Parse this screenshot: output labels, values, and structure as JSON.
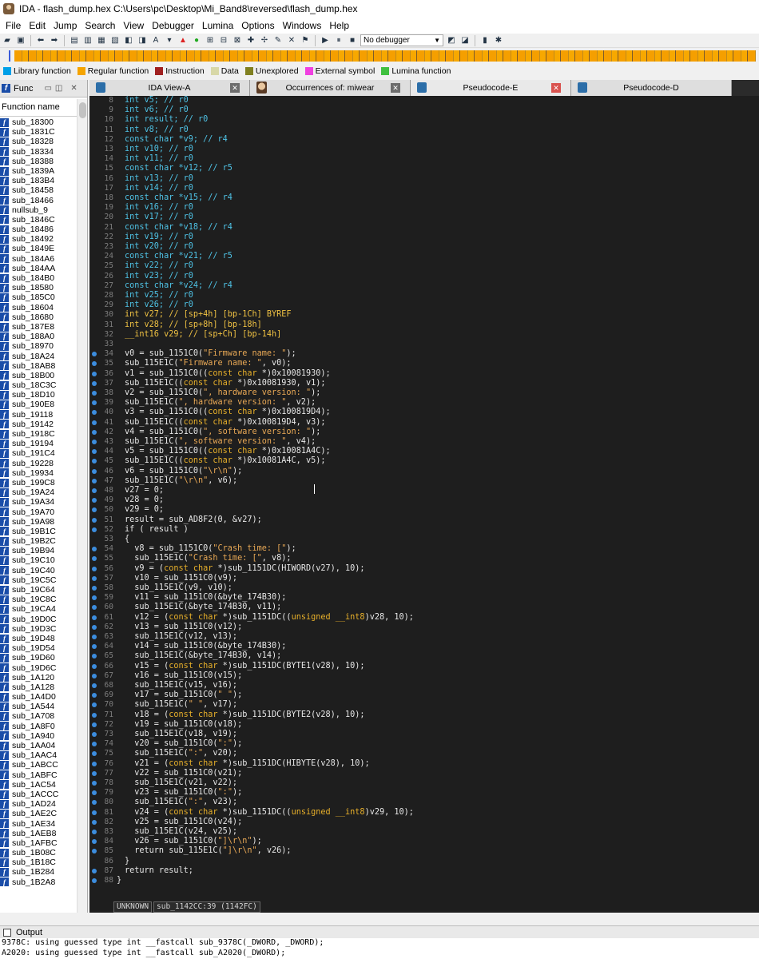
{
  "window": {
    "title": "IDA - flash_dump.hex C:\\Users\\pc\\Desktop\\Mi_Band8\\reversed\\flash_dump.hex"
  },
  "menu": [
    "File",
    "Edit",
    "Jump",
    "Search",
    "View",
    "Debugger",
    "Lumina",
    "Options",
    "Windows",
    "Help"
  ],
  "toolbar": {
    "debugger": "No debugger"
  },
  "legend": [
    {
      "label": "Library function",
      "color": "#00a0e8"
    },
    {
      "label": "Regular function",
      "color": "#f5a400"
    },
    {
      "label": "Instruction",
      "color": "#a02020"
    },
    {
      "label": "Data",
      "color": "#d8d8a8"
    },
    {
      "label": "Unexplored",
      "color": "#808020"
    },
    {
      "label": "External symbol",
      "color": "#f040e0"
    },
    {
      "label": "Lumina function",
      "color": "#40c040"
    }
  ],
  "functions_panel": {
    "tab_label": "Func",
    "column_header": "Function name",
    "items": [
      "sub_18300",
      "sub_1831C",
      "sub_18328",
      "sub_18334",
      "sub_18388",
      "sub_1839A",
      "sub_183B4",
      "sub_18458",
      "sub_18466",
      "nullsub_9",
      "sub_1846C",
      "sub_18486",
      "sub_18492",
      "sub_1849E",
      "sub_184A6",
      "sub_184AA",
      "sub_184B0",
      "sub_18580",
      "sub_185C0",
      "sub_18604",
      "sub_18680",
      "sub_187E8",
      "sub_188A0",
      "sub_18970",
      "sub_18A24",
      "sub_18AB8",
      "sub_18B00",
      "sub_18C3C",
      "sub_18D10",
      "sub_190E8",
      "sub_19118",
      "sub_19142",
      "sub_1918C",
      "sub_19194",
      "sub_191C4",
      "sub_19228",
      "sub_19934",
      "sub_199C8",
      "sub_19A24",
      "sub_19A34",
      "sub_19A70",
      "sub_19A98",
      "sub_19B1C",
      "sub_19B2C",
      "sub_19B94",
      "sub_19C10",
      "sub_19C40",
      "sub_19C5C",
      "sub_19C64",
      "sub_19C8C",
      "sub_19CA4",
      "sub_19D0C",
      "sub_19D3C",
      "sub_19D48",
      "sub_19D54",
      "sub_19D60",
      "sub_19D6C",
      "sub_1A120",
      "sub_1A128",
      "sub_1A4D0",
      "sub_1A544",
      "sub_1A708",
      "sub_1A8F0",
      "sub_1A940",
      "sub_1AA04",
      "sub_1AAC4",
      "sub_1ABCC",
      "sub_1ABFC",
      "sub_1AC54",
      "sub_1ACCC",
      "sub_1AD24",
      "sub_1AE2C",
      "sub_1AE34",
      "sub_1AEB8",
      "sub_1AFBC",
      "sub_1B08C",
      "sub_1B18C",
      "sub_1B284",
      "sub_1B2A8"
    ]
  },
  "tabs": [
    {
      "label": "IDA View-A",
      "active": false
    },
    {
      "label": "Occurrences of: miwear",
      "active": false
    },
    {
      "label": "Pseudocode-E",
      "active": true
    },
    {
      "label": "Pseudocode-D",
      "active": false
    }
  ],
  "code": [
    {
      "n": "8",
      "t": "int v5; // r0",
      "k": "decl"
    },
    {
      "n": "9",
      "t": "int v6; // r0",
      "k": "decl"
    },
    {
      "n": "10",
      "t": "int result; // r0",
      "k": "decl"
    },
    {
      "n": "11",
      "t": "int v8; // r0",
      "k": "decl"
    },
    {
      "n": "12",
      "t": "const char *v9; // r4",
      "k": "decl"
    },
    {
      "n": "13",
      "t": "int v10; // r0",
      "k": "decl"
    },
    {
      "n": "14",
      "t": "int v11; // r0",
      "k": "decl"
    },
    {
      "n": "15",
      "t": "const char *v12; // r5",
      "k": "decl"
    },
    {
      "n": "16",
      "t": "int v13; // r0",
      "k": "decl"
    },
    {
      "n": "17",
      "t": "int v14; // r0",
      "k": "decl"
    },
    {
      "n": "18",
      "t": "const char *v15; // r4",
      "k": "decl"
    },
    {
      "n": "19",
      "t": "int v16; // r0",
      "k": "decl"
    },
    {
      "n": "20",
      "t": "int v17; // r0",
      "k": "decl"
    },
    {
      "n": "21",
      "t": "const char *v18; // r4",
      "k": "decl"
    },
    {
      "n": "22",
      "t": "int v19; // r0",
      "k": "decl"
    },
    {
      "n": "23",
      "t": "int v20; // r0",
      "k": "decl"
    },
    {
      "n": "24",
      "t": "const char *v21; // r5",
      "k": "decl"
    },
    {
      "n": "25",
      "t": "int v22; // r0",
      "k": "decl"
    },
    {
      "n": "26",
      "t": "int v23; // r0",
      "k": "decl"
    },
    {
      "n": "27",
      "t": "const char *v24; // r4",
      "k": "decl"
    },
    {
      "n": "28",
      "t": "int v25; // r0",
      "k": "decl"
    },
    {
      "n": "29",
      "t": "int v26; // r0",
      "k": "decl"
    },
    {
      "n": "30",
      "t": "int v27; // [sp+4h] [bp-1Ch] BYREF",
      "k": "decl2"
    },
    {
      "n": "31",
      "t": "int v28; // [sp+8h] [bp-18h]",
      "k": "decl2"
    },
    {
      "n": "32",
      "t": "__int16 v29; // [sp+Ch] [bp-14h]",
      "k": "decl2"
    },
    {
      "n": "33",
      "t": "",
      "k": ""
    },
    {
      "n": "34",
      "t": "v0 = sub_1151C0(\"Firmware name: \");",
      "k": "dot"
    },
    {
      "n": "35",
      "t": "sub_115E1C(\"Firmware name: \", v0);",
      "k": "dot"
    },
    {
      "n": "36",
      "t": "v1 = sub_1151C0((const char *)0x10081930);",
      "k": "dot"
    },
    {
      "n": "37",
      "t": "sub_115E1C((const char *)0x10081930, v1);",
      "k": "dot"
    },
    {
      "n": "38",
      "t": "v2 = sub_1151C0(\", hardware version: \");",
      "k": "dot"
    },
    {
      "n": "39",
      "t": "sub_115E1C(\", hardware version: \", v2);",
      "k": "dot"
    },
    {
      "n": "40",
      "t": "v3 = sub_1151C0((const char *)0x100819D4);",
      "k": "dot"
    },
    {
      "n": "41",
      "t": "sub_115E1C((const char *)0x100819D4, v3);",
      "k": "dot"
    },
    {
      "n": "42",
      "t": "v4 = sub_1151C0(\", software version: \");",
      "k": "dot"
    },
    {
      "n": "43",
      "t": "sub_115E1C(\", software version: \", v4);",
      "k": "dot"
    },
    {
      "n": "44",
      "t": "v5 = sub_1151C0((const char *)0x10081A4C);",
      "k": "dot"
    },
    {
      "n": "45",
      "t": "sub_115E1C((const char *)0x10081A4C, v5);",
      "k": "dot"
    },
    {
      "n": "46",
      "t": "v6 = sub_1151C0(\"\\r\\n\");",
      "k": "dot"
    },
    {
      "n": "47",
      "t": "sub_115E1C(\"\\r\\n\", v6);",
      "k": "dot"
    },
    {
      "n": "48",
      "t": "v27 = 0;",
      "k": "dot"
    },
    {
      "n": "49",
      "t": "v28 = 0;",
      "k": "dot"
    },
    {
      "n": "50",
      "t": "v29 = 0;",
      "k": "dot"
    },
    {
      "n": "51",
      "t": "result = sub_AD8F2(0, &v27);",
      "k": "dot"
    },
    {
      "n": "52",
      "t": "if ( result )",
      "k": "dot"
    },
    {
      "n": "53",
      "t": "{",
      "k": ""
    },
    {
      "n": "54",
      "t": "  v8 = sub_1151C0(\"Crash time: [\");",
      "k": "dot"
    },
    {
      "n": "55",
      "t": "  sub_115E1C(\"Crash time: [\", v8);",
      "k": "dot"
    },
    {
      "n": "56",
      "t": "  v9 = (const char *)sub_1151DC(HIWORD(v27), 10);",
      "k": "dot"
    },
    {
      "n": "57",
      "t": "  v10 = sub_1151C0(v9);",
      "k": "dot"
    },
    {
      "n": "58",
      "t": "  sub_115E1C(v9, v10);",
      "k": "dot"
    },
    {
      "n": "59",
      "t": "  v11 = sub_1151C0(&byte_174B30);",
      "k": "dot"
    },
    {
      "n": "60",
      "t": "  sub_115E1C(&byte_174B30, v11);",
      "k": "dot"
    },
    {
      "n": "61",
      "t": "  v12 = (const char *)sub_1151DC((unsigned __int8)v28, 10);",
      "k": "dot"
    },
    {
      "n": "62",
      "t": "  v13 = sub_1151C0(v12);",
      "k": "dot"
    },
    {
      "n": "63",
      "t": "  sub_115E1C(v12, v13);",
      "k": "dot"
    },
    {
      "n": "64",
      "t": "  v14 = sub_1151C0(&byte_174B30);",
      "k": "dot"
    },
    {
      "n": "65",
      "t": "  sub_115E1C(&byte_174B30, v14);",
      "k": "dot"
    },
    {
      "n": "66",
      "t": "  v15 = (const char *)sub_1151DC(BYTE1(v28), 10);",
      "k": "dot"
    },
    {
      "n": "67",
      "t": "  v16 = sub_1151C0(v15);",
      "k": "dot"
    },
    {
      "n": "68",
      "t": "  sub_115E1C(v15, v16);",
      "k": "dot"
    },
    {
      "n": "69",
      "t": "  v17 = sub_1151C0(\" \");",
      "k": "dot"
    },
    {
      "n": "70",
      "t": "  sub_115E1C(\" \", v17);",
      "k": "dot"
    },
    {
      "n": "71",
      "t": "  v18 = (const char *)sub_1151DC(BYTE2(v28), 10);",
      "k": "dot"
    },
    {
      "n": "72",
      "t": "  v19 = sub_1151C0(v18);",
      "k": "dot"
    },
    {
      "n": "73",
      "t": "  sub_115E1C(v18, v19);",
      "k": "dot"
    },
    {
      "n": "74",
      "t": "  v20 = sub_1151C0(\":\");",
      "k": "dot"
    },
    {
      "n": "75",
      "t": "  sub_115E1C(\":\", v20);",
      "k": "dot"
    },
    {
      "n": "76",
      "t": "  v21 = (const char *)sub_1151DC(HIBYTE(v28), 10);",
      "k": "dot"
    },
    {
      "n": "77",
      "t": "  v22 = sub_1151C0(v21);",
      "k": "dot"
    },
    {
      "n": "78",
      "t": "  sub_115E1C(v21, v22);",
      "k": "dot"
    },
    {
      "n": "79",
      "t": "  v23 = sub_1151C0(\":\");",
      "k": "dot"
    },
    {
      "n": "80",
      "t": "  sub_115E1C(\":\", v23);",
      "k": "dot"
    },
    {
      "n": "81",
      "t": "  v24 = (const char *)sub_1151DC((unsigned __int8)v29, 10);",
      "k": "dot"
    },
    {
      "n": "82",
      "t": "  v25 = sub_1151C0(v24);",
      "k": "dot"
    },
    {
      "n": "83",
      "t": "  sub_115E1C(v24, v25);",
      "k": "dot"
    },
    {
      "n": "84",
      "t": "  v26 = sub_1151C0(\"]\\r\\n\");",
      "k": "dot"
    },
    {
      "n": "85",
      "t": "  return sub_115E1C(\"]\\r\\n\", v26);",
      "k": "dot"
    },
    {
      "n": "86",
      "t": "}",
      "k": ""
    },
    {
      "n": "87",
      "t": "return result;",
      "k": "dot"
    },
    {
      "n": "88",
      "t": "}",
      "k": "dot",
      "outdent": true
    }
  ],
  "status": {
    "mode": "UNKNOWN",
    "location": "sub_1142CC:39 (1142FC)"
  },
  "output": {
    "title": "Output",
    "lines": [
      "9378C: using guessed type int __fastcall sub_9378C(_DWORD, _DWORD);",
      "A2020: using guessed type int __fastcall sub_A2020(_DWORD);"
    ]
  }
}
